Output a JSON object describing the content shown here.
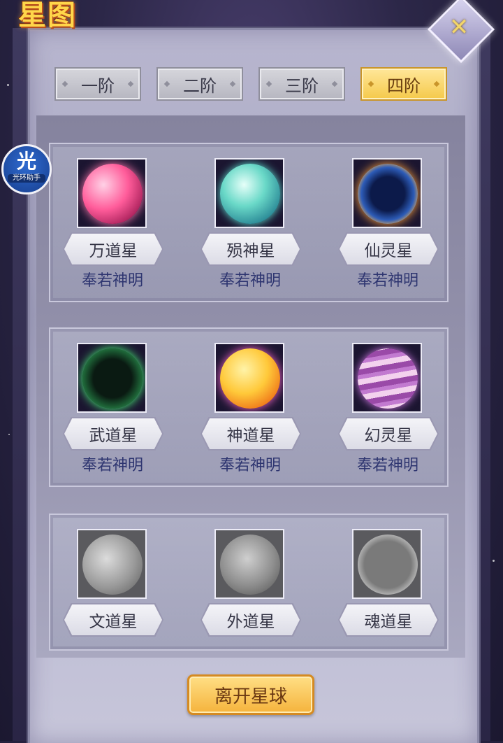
{
  "window": {
    "title": "星图"
  },
  "close_label": "✕",
  "tabs": [
    {
      "label": "一阶",
      "active": false
    },
    {
      "label": "二阶",
      "active": false
    },
    {
      "label": "三阶",
      "active": false
    },
    {
      "label": "四阶",
      "active": true
    }
  ],
  "groups": [
    {
      "planets": [
        {
          "name": "万道星",
          "status": "奉若神明",
          "locked": false
        },
        {
          "name": "殒神星",
          "status": "奉若神明",
          "locked": false
        },
        {
          "name": "仙灵星",
          "status": "奉若神明",
          "locked": false
        }
      ]
    },
    {
      "planets": [
        {
          "name": "武道星",
          "status": "奉若神明",
          "locked": false
        },
        {
          "name": "神道星",
          "status": "奉若神明",
          "locked": false
        },
        {
          "name": "幻灵星",
          "status": "奉若神明",
          "locked": false
        }
      ]
    },
    {
      "planets": [
        {
          "name": "文道星",
          "status": "",
          "locked": true
        },
        {
          "name": "外道星",
          "status": "",
          "locked": true
        },
        {
          "name": "魂道星",
          "status": "",
          "locked": true
        }
      ]
    }
  ],
  "leave_button": "离开星球",
  "assistant_badge": {
    "char": "光",
    "label": "光环助手"
  },
  "colors": {
    "active_tab": "#f5c94a",
    "status_text": "#2e3570",
    "button": "#f5b33c"
  }
}
